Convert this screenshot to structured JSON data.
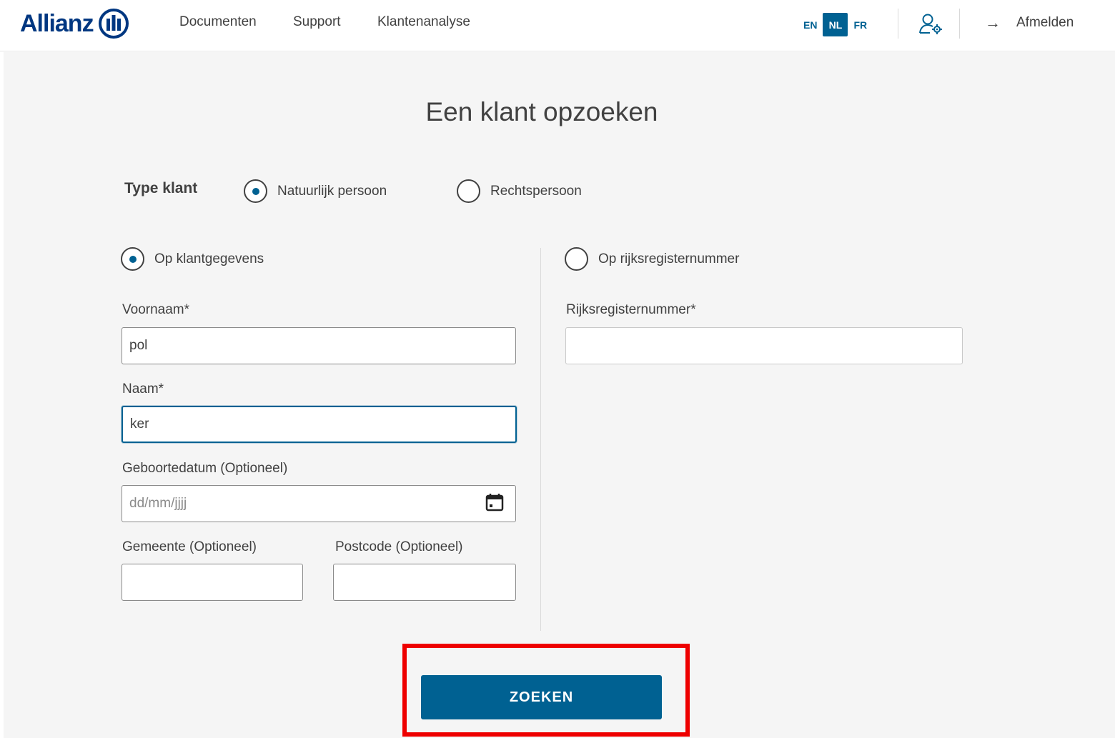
{
  "header": {
    "brand": "Allianz",
    "nav": [
      {
        "label": "Documenten"
      },
      {
        "label": "Support"
      },
      {
        "label": "Klantenanalyse"
      }
    ],
    "languages": [
      {
        "code": "EN",
        "active": false
      },
      {
        "code": "NL",
        "active": true
      },
      {
        "code": "FR",
        "active": false
      }
    ],
    "user_icon": "user-settings-icon",
    "logout_icon": "arrow-right-icon",
    "logout_label": "Afmelden"
  },
  "page": {
    "title": "Een klant opzoeken"
  },
  "client_type": {
    "label": "Type klant",
    "options": [
      {
        "label": "Natuurlijk persoon",
        "checked": true
      },
      {
        "label": "Rechtspersoon",
        "checked": false
      }
    ]
  },
  "search_mode": {
    "by_data": {
      "label": "Op klantgegevens",
      "checked": true
    },
    "by_national_number": {
      "label": "Op rijksregisternummer",
      "checked": false
    }
  },
  "form": {
    "firstname": {
      "label": "Voornaam*",
      "value": "pol"
    },
    "lastname": {
      "label": "Naam*",
      "value": "ker"
    },
    "birthdate": {
      "label": "Geboortedatum (Optioneel)",
      "placeholder": "dd/mm/jjjj",
      "value": "",
      "icon": "calendar-icon"
    },
    "municipality": {
      "label": "Gemeente (Optioneel)",
      "value": ""
    },
    "postcode": {
      "label": "Postcode (Optioneel)",
      "value": ""
    },
    "national_number": {
      "label": "Rijksregisternummer*",
      "value": ""
    }
  },
  "actions": {
    "search_label": "ZOEKEN"
  },
  "colors": {
    "brand": "#003781",
    "primary": "#006192",
    "highlight": "#ee0000",
    "background": "#f5f5f5"
  }
}
